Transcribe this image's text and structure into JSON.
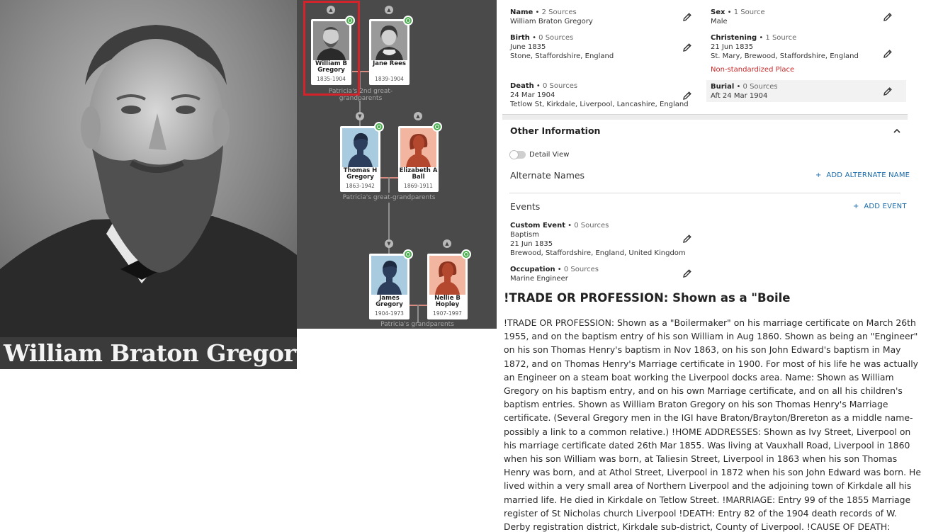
{
  "portrait": {
    "caption": "William Braton Gregory"
  },
  "tree": {
    "generations": [
      {
        "label": "Patricia's 2nd great-grandparents",
        "people": [
          {
            "name": "William B Gregory",
            "dates": "1835-1904",
            "sex": "male",
            "selected": true,
            "has_photo": true
          },
          {
            "name": "Jane Rees",
            "dates": "1839-1904",
            "sex": "female",
            "selected": false,
            "has_photo": true
          }
        ]
      },
      {
        "label": "Patricia's great-grandparents",
        "people": [
          {
            "name": "Thomas H Gregory",
            "dates": "1863-1942",
            "sex": "male",
            "has_photo": false
          },
          {
            "name": "Elizabeth A Ball",
            "dates": "1869-1911",
            "sex": "female",
            "has_photo": false
          }
        ]
      },
      {
        "label": "Patricia's grandparents",
        "people": [
          {
            "name": "James Gregory",
            "dates": "1904-1973",
            "sex": "male",
            "has_photo": false
          },
          {
            "name": "Nellie B Hopley",
            "dates": "1907-1997",
            "sex": "female",
            "has_photo": false
          }
        ]
      }
    ],
    "colors": {
      "male_bg": "#a9cbe0",
      "male_figure": "#2d3e5c",
      "female_bg": "#f2b6a0",
      "female_figure": "#b4482f",
      "hint": "#4caf50",
      "selected": "#d4232b"
    }
  },
  "facts": {
    "name": {
      "label": "Name",
      "sources": "2 Sources",
      "lines": [
        "William Braton Gregory"
      ]
    },
    "sex": {
      "label": "Sex",
      "sources": "1 Source",
      "lines": [
        "Male"
      ]
    },
    "birth": {
      "label": "Birth",
      "sources": "0 Sources",
      "lines": [
        "June 1835",
        "Stone, Staffordshire, England"
      ]
    },
    "christening": {
      "label": "Christening",
      "sources": "1 Source",
      "lines": [
        "21 Jun 1835",
        "St. Mary, Brewood, Staffordshire, England"
      ],
      "warning": "Non-standardized Place"
    },
    "death": {
      "label": "Death",
      "sources": "0 Sources",
      "lines": [
        "24 Mar 1904",
        "Tetlow St, Kirkdale, Liverpool, Lancashire, England"
      ]
    },
    "burial": {
      "label": "Burial",
      "sources": "0 Sources",
      "lines": [
        "Aft 24 Mar 1904"
      ]
    }
  },
  "other": {
    "title": "Other Information",
    "detail_view_label": "Detail View",
    "alternate_names_title": "Alternate Names",
    "add_alternate_name": "ADD ALTERNATE NAME",
    "events_title": "Events",
    "add_event": "ADD EVENT",
    "events": [
      {
        "label": "Custom Event",
        "sources": "0 Sources",
        "lines": [
          "Baptism",
          "21 Jun 1835",
          "Brewood, Staffordshire, England, United Kingdom"
        ]
      },
      {
        "label": "Occupation",
        "sources": "0 Sources",
        "lines": [
          "Marine Engineer"
        ]
      }
    ]
  },
  "notes": {
    "heading": "!TRADE OR PROFESSION: Shown as a \"Boile",
    "body": " !TRADE OR PROFESSION: Shown as a \"Boilermaker\" on his marriage certificate on March 26th 1955, and on the baptism entry of his son William in Aug 1860. Shown as being an \"Engineer\" on his son Thomas Henry's baptism in Nov 1863, on his son John Edward's baptism in May 1872, and on Thomas Henry's Marriage certificate in 1900. For most of his life he was actually an Engineer on a steam boat working the Liverpool docks area. Name: Shown as William Gregory on his baptism entry, and on his own Marriage certificate, and on all his children's baptism entries. Shown as William Braton Gregory on his son Thomas Henry's Marriage certificate. (Several Gregory men in the IGI have Braton/Brayton/Brereton as a middle name-possibly a link to a common relative.) !HOME ADDRESSES: Shown as Ivy Street, Liverpool on his marriage certificate dated 26th Mar 1855. Was living at Vauxhall Road, Liverpool in 1860 when his son William was born, at Taliesin Street, Liverpool in 1863 when his son Thomas Henry was born, and at Athol Street, Liverpool in 1872 when his son John Edward was born. He lived within a very small area of Northern Liverpool and the adjoining town of Kirkdale all his married life. He died in Kirkdale on Tetlow Street. !MARRIAGE: Entry 99 of the 1855 Marriage register of St Nicholas church Liverpool !DEATH: Entry 82 of the 1904 death records of W. Derby registration district, Kirkdale sub-district, County of Liverpool. !CAUSE OF DEATH: Cardiac disease per death certificate. Non-standard"
  }
}
